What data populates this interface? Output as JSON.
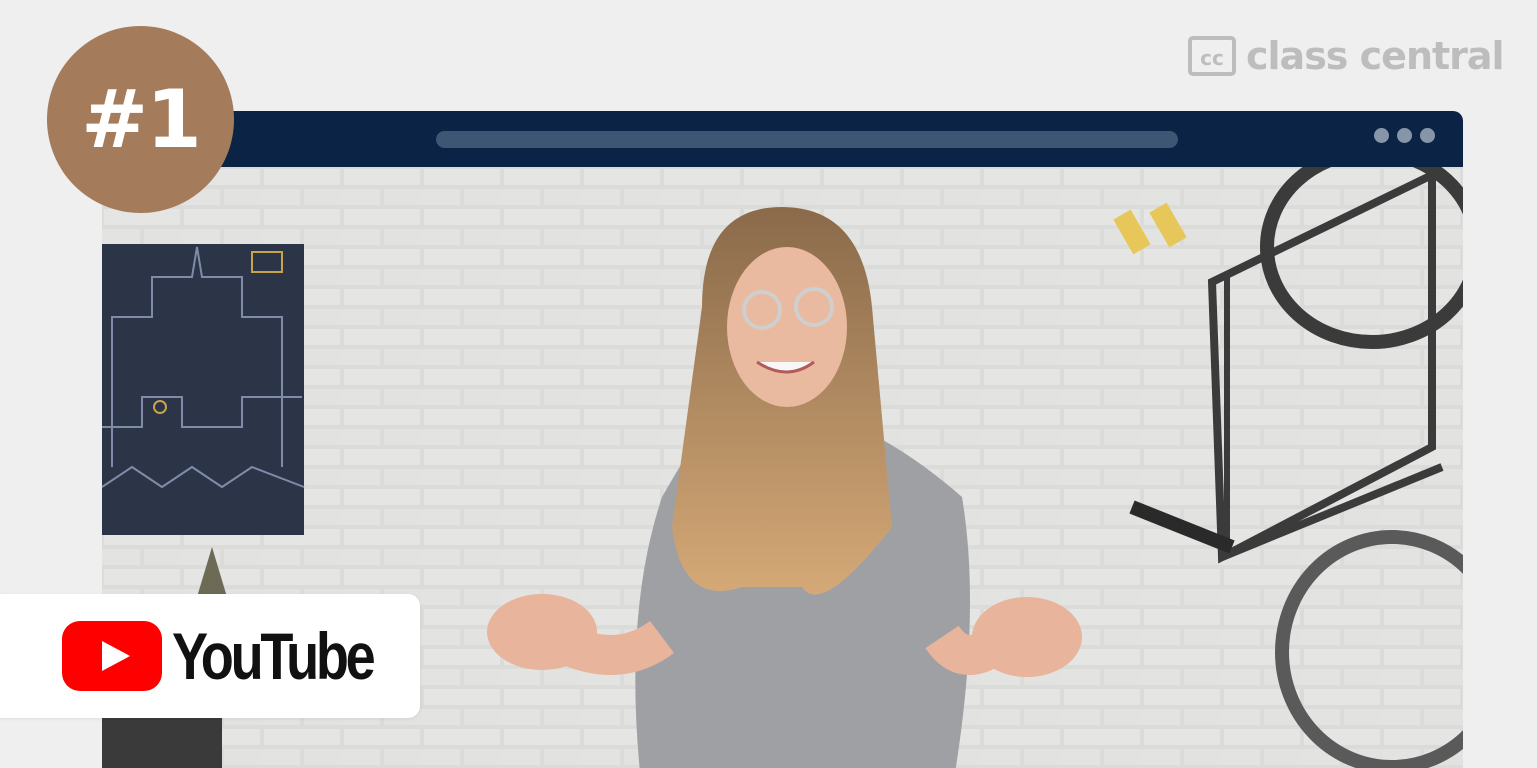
{
  "brand": {
    "icon_text": "cc",
    "name": "class central",
    "color": "#bdbdbd"
  },
  "browser": {
    "bar_color": "#0b2446",
    "address_bar_color": "#3d5674",
    "window_dots": 3
  },
  "rank": {
    "label": "#1",
    "color": "#a47b5b"
  },
  "platform": {
    "name": "YouTube",
    "logo_icon": "youtube-play-icon",
    "logo_color": "#ff0000"
  },
  "video": {
    "scene": "presenter-thumbnail"
  }
}
